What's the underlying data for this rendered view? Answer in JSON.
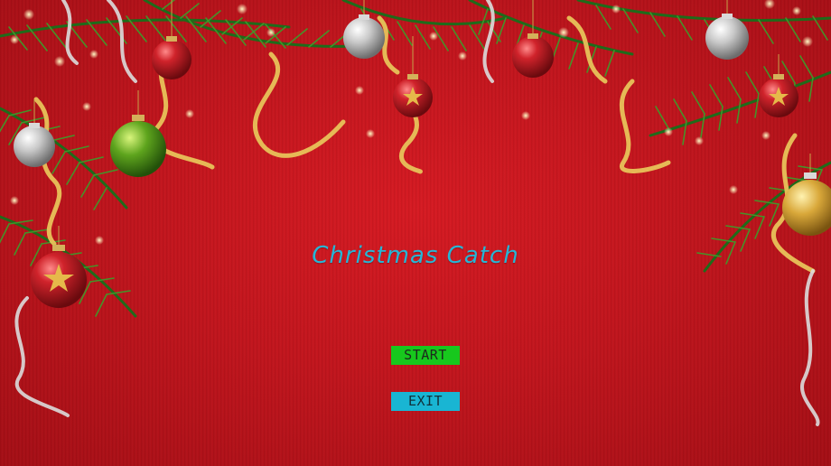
{
  "game": {
    "title": "Christmas Catch"
  },
  "menu": {
    "start_label": "START",
    "exit_label": "EXIT"
  },
  "colors": {
    "background": "#c2151d",
    "title": "#26b6d6",
    "start_button": "#17c81d",
    "exit_button": "#19b5d3"
  }
}
